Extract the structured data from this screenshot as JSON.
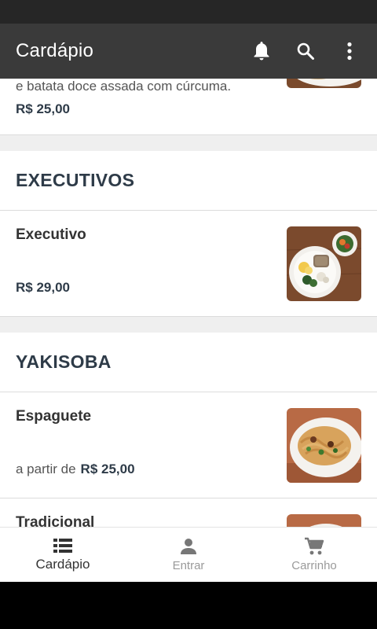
{
  "appbar": {
    "title": "Cardápio",
    "icons": [
      "bell-icon",
      "search-icon",
      "more-vert-icon"
    ]
  },
  "top_item": {
    "description": "e batata doce assada com cúrcuma.",
    "price": "R$ 25,00"
  },
  "sections": [
    {
      "title": "EXECUTIVOS",
      "items": [
        {
          "name": "Executivo",
          "price_prefix": "",
          "price": "R$ 29,00"
        }
      ]
    },
    {
      "title": "YAKISOBA",
      "items": [
        {
          "name": "Espaguete",
          "price_prefix": "a partir de",
          "price": "R$ 25,00"
        },
        {
          "name": "Tradicional"
        }
      ]
    }
  ],
  "bottom_nav": [
    {
      "label": "Cardápio",
      "icon": "list-icon",
      "active": true
    },
    {
      "label": "Entrar",
      "icon": "person-icon",
      "active": false
    },
    {
      "label": "Carrinho",
      "icon": "cart-icon",
      "active": false
    }
  ],
  "colors": {
    "appbar": "#3a3a3a",
    "statusbar": "#262626",
    "section_title": "#2e3b48",
    "background": "#efefef"
  }
}
